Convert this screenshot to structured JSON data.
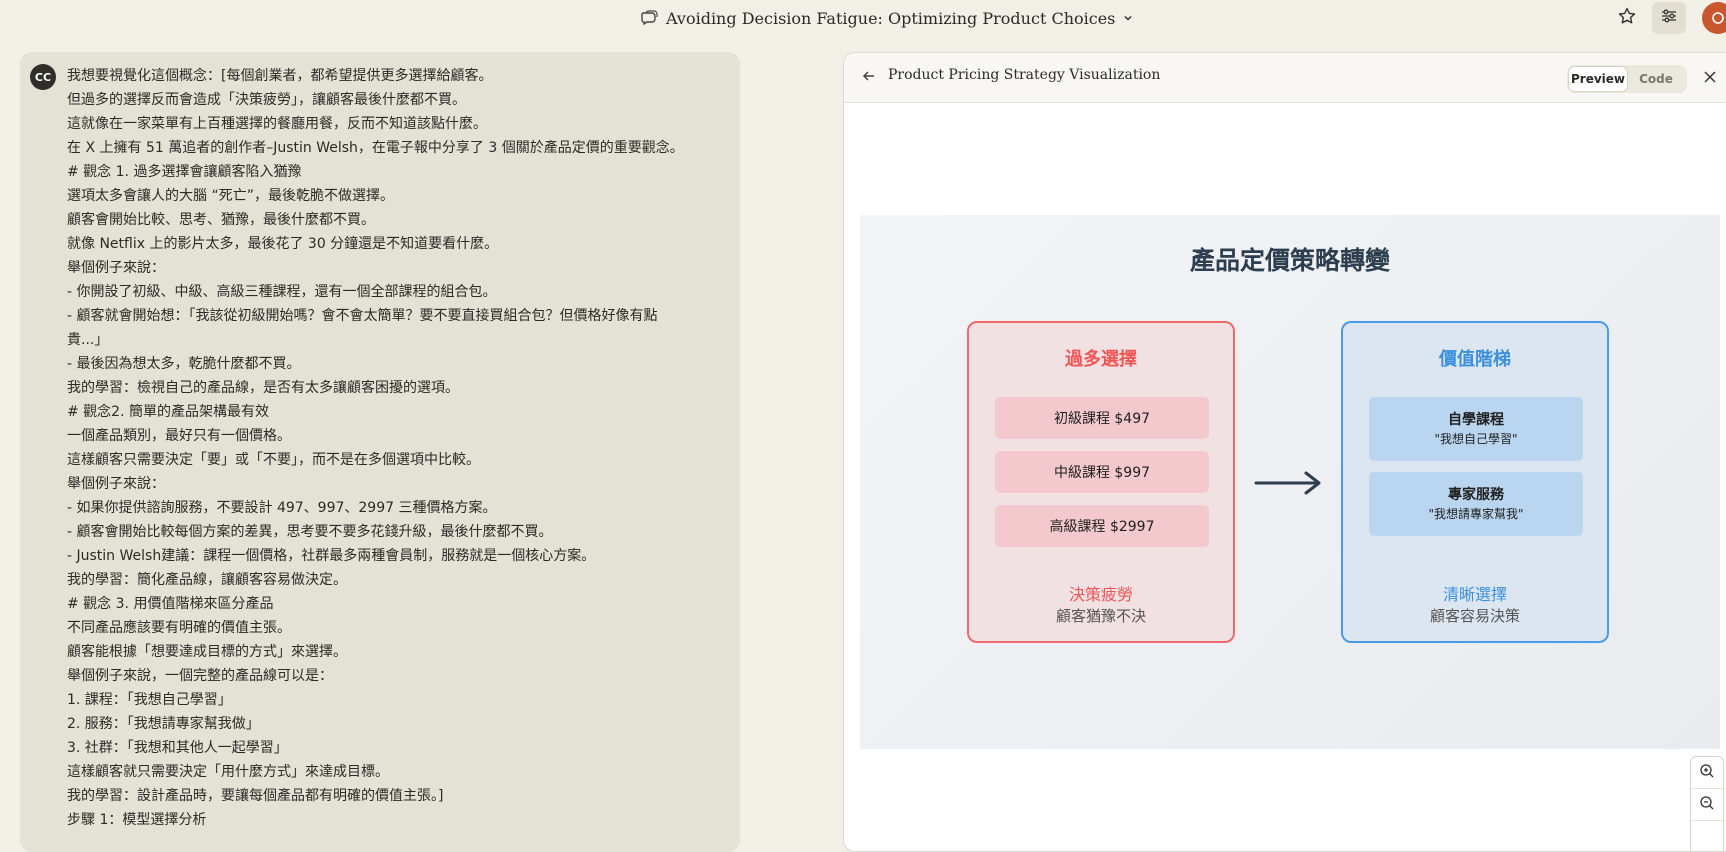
{
  "header": {
    "title": "Avoiding Decision Fatigue: Optimizing Product Choices",
    "chat_icon": "chat-bubble-icon",
    "dropdown_icon": "chevron-down-icon",
    "star_icon": "star-icon",
    "settings_icon": "sliders-icon"
  },
  "chat": {
    "avatar_initials": "CC",
    "lines": [
      "我想要視覺化這個概念：[每個創業者，都希望提供更多選擇給顧客。",
      "但過多的選擇反而會造成「決策疲勞」，讓顧客最後什麼都不買。",
      "這就像在一家菜單有上百種選擇的餐廳用餐，反而不知道該點什麼。",
      "在 X 上擁有 51 萬追者的創作者–Justin Welsh，在電子報中分享了 3 個關於產品定價的重要觀念。",
      "# 觀念 1. 過多選擇會讓顧客陷入猶豫",
      "選項太多會讓人的大腦 “死亡”，最後乾脆不做選擇。",
      "顧客會開始比較、思考、猶豫，最後什麼都不買。",
      "就像 Netflix 上的影片太多，最後花了 30 分鐘還是不知道要看什麼。",
      "舉個例子來說：",
      "- 你開設了初級、中級、高級三種課程，還有一個全部課程的組合包。",
      "- 顧客就會開始想：「我該從初級開始嗎？會不會太簡單？要不要直接買組合包？但價格好像有點",
      "貴...」",
      "- 最後因為想太多，乾脆什麼都不買。",
      "我的學習：檢視自己的產品線，是否有太多讓顧客困擾的選項。",
      "# 觀念2. 簡單的產品架構最有效",
      "一個產品類別，最好只有一個價格。",
      "這樣顧客只需要決定「要」或「不要」，而不是在多個選項中比較。",
      "舉個例子來說：",
      "- 如果你提供諮詢服務，不要設計 497、997、2997 三種價格方案。",
      "- 顧客會開始比較每個方案的差異，思考要不要多花錢升級，最後什麼都不買。",
      "- Justin Welsh建議：課程一個價格，社群最多兩種會員制，服務就是一個核心方案。",
      "我的學習：簡化產品線，讓顧客容易做決定。",
      "# 觀念 3. 用價值階梯來區分產品",
      "不同產品應該要有明確的價值主張。",
      "顧客能根據「想要達成目標的方式」來選擇。",
      "舉個例子來說，一個完整的產品線可以是：",
      "1. 課程：「我想自己學習」",
      "2. 服務：「我想請專家幫我做」",
      "3. 社群：「我想和其他人一起學習」",
      "這樣顧客就只需要決定「用什麼方式」來達成目標。",
      "我的學習：設計產品時，要讓每個產品都有明確的價值主張。]",
      "步驟 1：模型選擇分析"
    ]
  },
  "artifact": {
    "title": "Product Pricing Strategy Visualization",
    "tab_preview": "Preview",
    "tab_code": "Code",
    "back_icon": "arrow-left-icon",
    "close_icon": "close-icon",
    "zoom_in_icon": "zoom-in-icon",
    "zoom_out_icon": "zoom-out-icon"
  },
  "viz": {
    "title": "產品定價策略轉變",
    "left": {
      "heading": "過多選擇",
      "items": [
        "初級課程 $497",
        "中級課程 $997",
        "高級課程 $2997"
      ],
      "footer": "決策疲勞",
      "sub": "顧客猶豫不決",
      "color": "#ee5555"
    },
    "right": {
      "heading": "價值階梯",
      "items": [
        {
          "name": "自學課程",
          "desc": "\"我想自己學習\""
        },
        {
          "name": "專家服務",
          "desc": "\"我想請專家幫我\""
        }
      ],
      "footer": "清晰選擇",
      "sub": "顧客容易決策",
      "color": "#3b8fe0"
    },
    "arrow_icon": "arrow-right-icon"
  }
}
